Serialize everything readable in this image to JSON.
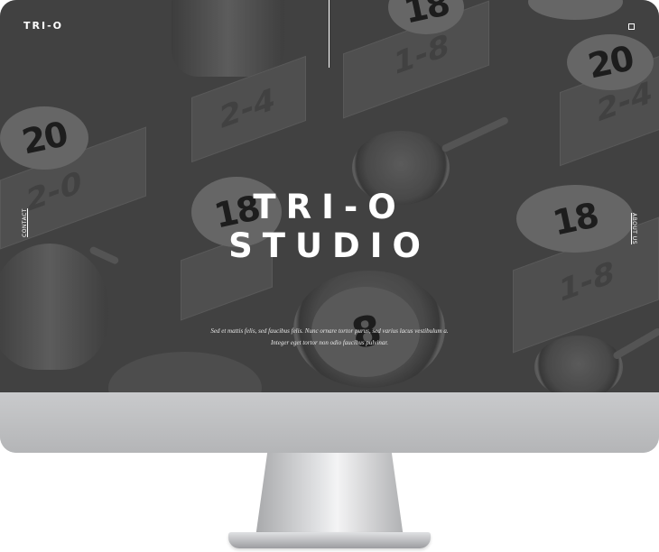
{
  "site": {
    "logo": "TRI-O",
    "menu_icon": "menu-icon",
    "side_left": "CONTACT",
    "side_right": "ABOUT US",
    "hero_line1": "TRI-O",
    "hero_line2": "STUDIO",
    "tagline_line1": "Sed et mattis felis, sed faucibus felis. Nunc ornare tortor purus, sed varius lacus vestibulum a.",
    "tagline_line2": "Integer eget tortor non odio faucibus pulvinar."
  },
  "scene": {
    "numbers": [
      "18",
      "20",
      "2-4",
      "1-8",
      "20",
      "2-0",
      "18",
      "1-8",
      "20",
      "2-4",
      "8",
      "18"
    ]
  },
  "colors": {
    "screen": "#4a4a4a",
    "bezel": "#c0c1c3",
    "text": "#ffffff"
  }
}
